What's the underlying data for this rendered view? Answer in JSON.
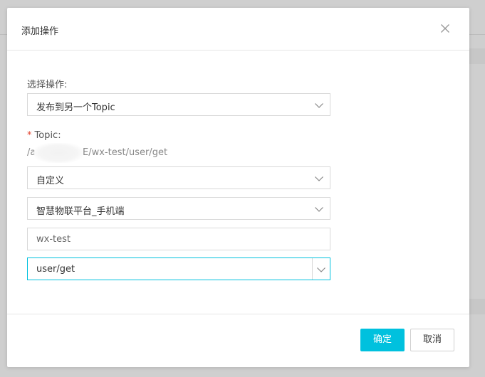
{
  "dialog": {
    "title": "添加操作",
    "close_icon": "close-icon"
  },
  "form": {
    "operation_label": "选择操作:",
    "operation_value": "发布到另一个Topic",
    "topic_label_star": "*",
    "topic_label": "Topic:",
    "topic_hint_prefix": "/a",
    "topic_hint_suffix": "E/wx-test/user/get",
    "topic_type_value": "自定义",
    "product_value": "智慧物联平台_手机端",
    "device_value": "wx-test",
    "topic_path_value": "user/get"
  },
  "footer": {
    "confirm_label": "确定",
    "cancel_label": "取消"
  },
  "colors": {
    "primary": "#00c1de",
    "required": "#e2432e",
    "overlay": "#cfcfcf"
  }
}
